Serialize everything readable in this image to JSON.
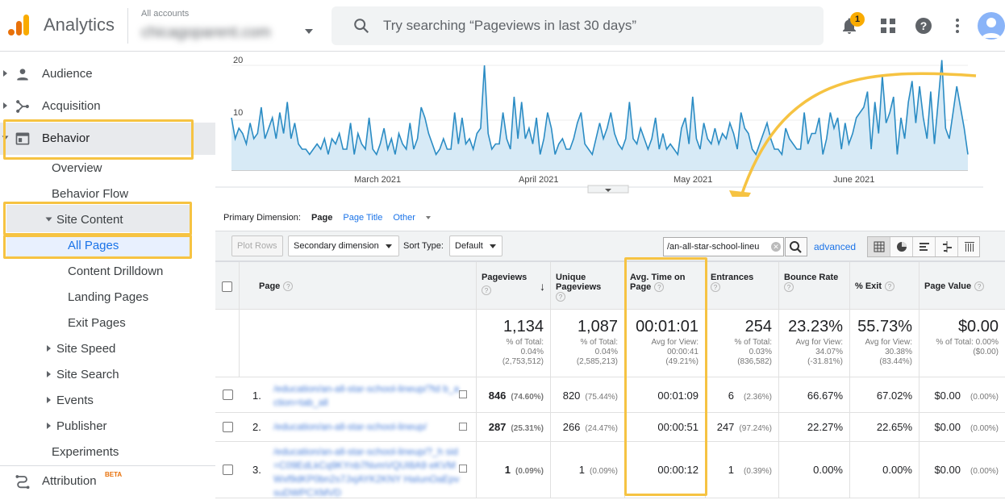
{
  "header": {
    "app_title": "Analytics",
    "accounts_label": "All accounts",
    "account_name": "chicagoparent.com",
    "search_placeholder": "Try searching “Pageviews in last 30 days”",
    "notification_count": "1"
  },
  "sidebar": {
    "items": [
      {
        "label": "Audience",
        "icon": "person-icon"
      },
      {
        "label": "Acquisition",
        "icon": "acquisition-icon"
      },
      {
        "label": "Behavior",
        "icon": "behavior-icon"
      }
    ],
    "behavior_sub": [
      "Overview",
      "Behavior Flow"
    ],
    "site_content": "Site Content",
    "site_content_sub": [
      "All Pages",
      "Content Drilldown",
      "Landing Pages",
      "Exit Pages"
    ],
    "behavior_more": [
      "Site Speed",
      "Site Search",
      "Events",
      "Publisher"
    ],
    "experiments": "Experiments",
    "attribution": "Attribution",
    "attribution_badge": "BETA"
  },
  "chart_data": {
    "type": "line",
    "y_ticks": [
      "20",
      "10"
    ],
    "x_labels": [
      "March 2021",
      "April 2021",
      "May 2021",
      "June 2021"
    ],
    "series": [
      {
        "values": [
          10,
          6,
          8,
          7,
          5,
          9,
          6,
          7,
          12,
          6,
          8,
          10,
          6,
          11,
          7,
          13,
          6,
          9,
          5,
          4,
          4,
          3,
          4,
          5,
          4,
          6,
          3,
          6,
          5,
          7,
          4,
          4,
          9,
          3,
          7,
          5,
          4,
          10,
          4,
          3,
          5,
          8,
          4,
          6,
          3,
          7,
          5,
          4,
          9,
          4,
          6,
          12,
          10,
          7,
          5,
          3,
          4,
          6,
          4,
          4,
          11,
          5,
          10,
          5,
          6,
          4,
          7,
          8,
          20,
          7,
          4,
          5,
          5,
          11,
          6,
          4,
          14,
          6,
          13,
          6,
          8,
          5,
          10,
          3,
          6,
          11,
          8,
          3,
          5,
          6,
          4,
          4,
          6,
          9,
          11,
          5,
          4,
          3,
          6,
          9,
          6,
          8,
          11,
          7,
          5,
          4,
          6,
          13,
          6,
          5,
          8,
          6,
          4,
          6,
          10,
          4,
          7,
          4,
          5,
          4,
          3,
          8,
          10,
          5,
          14,
          6,
          4,
          9,
          6,
          5,
          8,
          5,
          7,
          6,
          9,
          7,
          4,
          11,
          8,
          7,
          4,
          3,
          5,
          7,
          9,
          6,
          4,
          4,
          3,
          8,
          6,
          5,
          4,
          4,
          11,
          5,
          7,
          7,
          10,
          3,
          6,
          11,
          8,
          10,
          4,
          9,
          5,
          7,
          10,
          11,
          12,
          15,
          4,
          13,
          7,
          18,
          9,
          11,
          14,
          3,
          10,
          6,
          13,
          17,
          9,
          16,
          10,
          6,
          15,
          5,
          13,
          21,
          8,
          6,
          11,
          16,
          12,
          8,
          3
        ]
      }
    ]
  },
  "primary_dimension": {
    "label": "Primary Dimension:",
    "page": "Page",
    "page_title": "Page Title",
    "other": "Other"
  },
  "toolbar": {
    "plot_rows": "Plot Rows",
    "secondary_dimension": "Secondary dimension",
    "sort_type_label": "Sort Type:",
    "sort_type_value": "Default",
    "filter_value": "/an-all-star-school-lineu",
    "advanced": "advanced"
  },
  "table": {
    "headers": {
      "page": "Page",
      "pageviews": "Pageviews",
      "unique_pageviews": "Unique Pageviews",
      "avg_time": "Avg. Time on Page",
      "entrances": "Entrances",
      "bounce_rate": "Bounce Rate",
      "exit": "% Exit",
      "page_value": "Page Value"
    },
    "summary": {
      "pageviews": {
        "value": "1,134",
        "l1": "% of Total:",
        "l2": "0.04%",
        "l3": "(2,753,512)"
      },
      "unique_pageviews": {
        "value": "1,087",
        "l1": "% of Total:",
        "l2": "0.04%",
        "l3": "(2,585,213)"
      },
      "avg_time": {
        "value": "00:01:01",
        "l1": "Avg for View:",
        "l2": "00:00:41",
        "l3": "(49.21%)"
      },
      "entrances": {
        "value": "254",
        "l1": "% of Total:",
        "l2": "0.03%",
        "l3": "(836,582)"
      },
      "bounce_rate": {
        "value": "23.23%",
        "l1": "Avg for View:",
        "l2": "34.07%",
        "l3": "(-31.81%)"
      },
      "exit": {
        "value": "55.73%",
        "l1": "Avg for View:",
        "l2": "30.38%",
        "l3": "(83.44%)"
      },
      "page_value": {
        "value": "$0.00",
        "l1": "% of Total: 0.00%",
        "l2": "($0.00)"
      }
    },
    "rows": [
      {
        "num": "1.",
        "page": "/education/an-all-star-school-lineup/?td b_action=tab_all",
        "pageviews": "846",
        "pageviews_pct": "(74.60%)",
        "unique": "820",
        "unique_pct": "(75.44%)",
        "avg_time": "00:01:09",
        "entrances": "6",
        "entrances_pct": "(2.36%)",
        "bounce": "66.67%",
        "exit": "67.02%",
        "value": "$0.00",
        "value_pct": "(0.00%)"
      },
      {
        "num": "2.",
        "page": "/education/an-all-star-school-lineup/",
        "pageviews": "287",
        "pageviews_pct": "(25.31%)",
        "unique": "266",
        "unique_pct": "(24.47%)",
        "avg_time": "00:00:51",
        "entrances": "247",
        "entrances_pct": "(97.24%)",
        "bounce": "22.27%",
        "exit": "22.65%",
        "value": "$0.00",
        "value_pct": "(0.00%)"
      },
      {
        "num": "3.",
        "page": "/education/an-all-star-school-lineup/?_h sid=C09EdLkCq9KYnb7NvmVQUI8A9 eKVMWxf9dKP0bn2s7JxjAYK2KNY HaIunOaEpvsuDWPCXMVD",
        "pageviews": "1",
        "pageviews_pct": "(0.09%)",
        "unique": "1",
        "unique_pct": "(0.09%)",
        "avg_time": "00:00:12",
        "entrances": "1",
        "entrances_pct": "(0.39%)",
        "bounce": "0.00%",
        "exit": "0.00%",
        "value": "$0.00",
        "value_pct": "(0.00%)"
      }
    ]
  },
  "colors": {
    "highlight": "#f6c342",
    "line": "#2b8cc4",
    "fill": "#d7eaf6",
    "link": "#1a73e8"
  }
}
